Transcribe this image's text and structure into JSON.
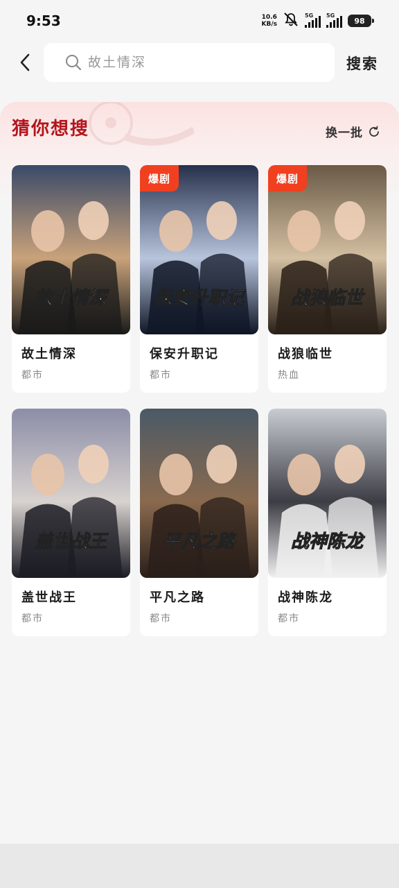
{
  "status": {
    "time": "9:53",
    "net_speed_value": "10.6",
    "net_speed_unit": "KB/s",
    "sim1": "5G",
    "sim2": "5G",
    "battery": "98"
  },
  "search": {
    "placeholder": "故土情深",
    "button": "搜索"
  },
  "suggest": {
    "title": "猜你想搜",
    "refresh_label": "换一批",
    "cards": [
      {
        "title": "故土情深",
        "genre": "都市",
        "badge": "",
        "poster_text": "故土情深",
        "colors": [
          "#3a4a68",
          "#c9a27a",
          "#1a1a1a"
        ]
      },
      {
        "title": "保安升职记",
        "genre": "都市",
        "badge": "爆剧",
        "poster_text": "保安升职记",
        "colors": [
          "#26304c",
          "#b7c4dc",
          "#0f1626"
        ]
      },
      {
        "title": "战狼临世",
        "genre": "热血",
        "badge": "爆剧",
        "poster_text": "战狼临世",
        "colors": [
          "#6a5a46",
          "#d4c0a2",
          "#2a2018"
        ]
      },
      {
        "title": "盖世战王",
        "genre": "都市",
        "badge": "",
        "poster_text": "盖世战王",
        "colors": [
          "#8c8ea8",
          "#d8d2cf",
          "#1c1c24"
        ]
      },
      {
        "title": "平凡之路",
        "genre": "都市",
        "badge": "",
        "poster_text": "平凡之路",
        "colors": [
          "#4b5a66",
          "#8a6a4e",
          "#2a1f1a"
        ]
      },
      {
        "title": "战神陈龙",
        "genre": "都市",
        "badge": "",
        "poster_text": "战神陈龙",
        "colors": [
          "#c8ccd2",
          "#3c3c44",
          "#f0f0f0"
        ]
      }
    ]
  },
  "colors": {
    "accent": "#b3151c",
    "badge": "#f0401f",
    "background": "#f5f5f5"
  }
}
